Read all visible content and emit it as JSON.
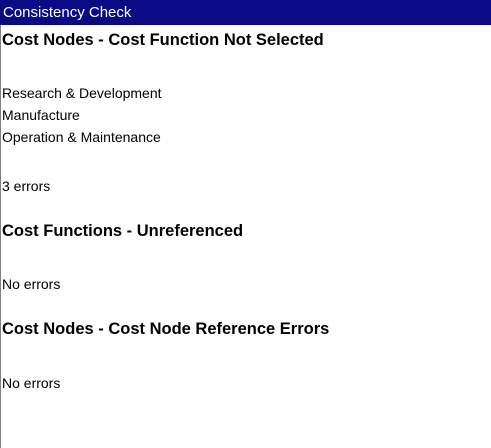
{
  "window": {
    "title": "Consistency Check"
  },
  "sections": [
    {
      "heading": "Cost Nodes - Cost Function Not Selected",
      "items": [
        "Research & Development",
        "Manufacture",
        "Operation & Maintenance"
      ],
      "result": "3 errors"
    },
    {
      "heading": "Cost Functions - Unreferenced",
      "items": [],
      "result": "No errors"
    },
    {
      "heading": "Cost Nodes - Cost Node Reference Errors",
      "items": [],
      "result": "No errors"
    }
  ],
  "colors": {
    "titlebar_bg": "#0a0a84",
    "titlebar_text": "#ffffff",
    "background": "#ffffff"
  }
}
